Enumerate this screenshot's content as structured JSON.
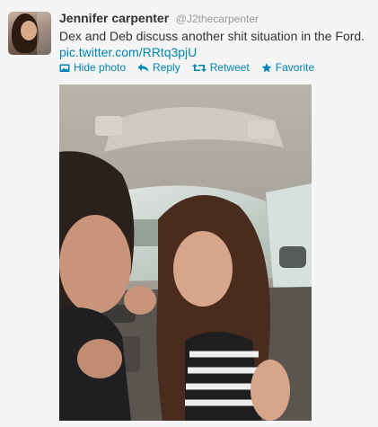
{
  "tweet": {
    "author_name": "Jennifer carpenter",
    "author_handle": "@J2thecarpenter",
    "text": "Dex and Deb discuss another shit situation in the Ford.",
    "link": "pic.twitter.com/RRtq3pjU"
  },
  "actions": {
    "hide_photo": "Hide photo",
    "reply": "Reply",
    "retweet": "Retweet",
    "favorite": "Favorite"
  },
  "colors": {
    "link": "#0084b4",
    "name": "#333333",
    "handle": "#999999",
    "background": "#f5f5f5"
  },
  "icons": {
    "hide_photo": "photo-icon",
    "reply": "reply-arrow-icon",
    "retweet": "retweet-icon",
    "favorite": "star-icon"
  }
}
